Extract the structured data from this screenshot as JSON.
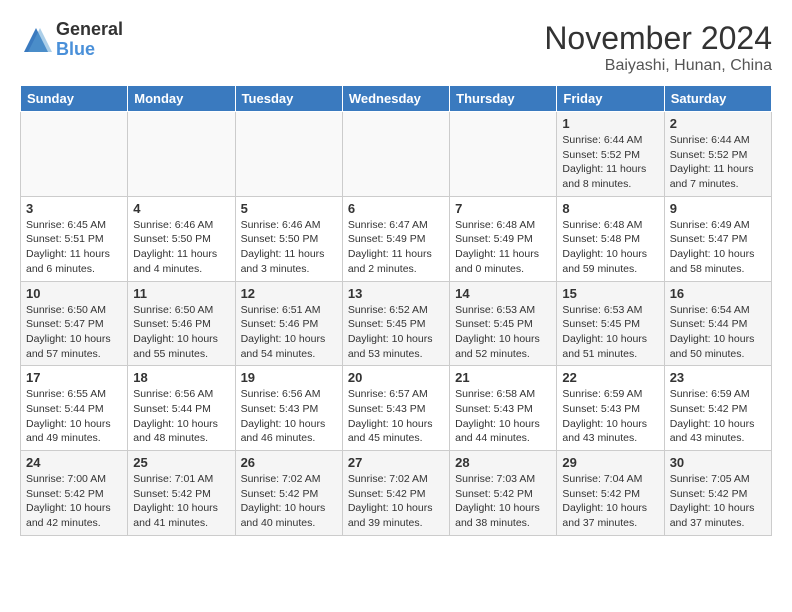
{
  "header": {
    "logo_general": "General",
    "logo_blue": "Blue",
    "month_title": "November 2024",
    "location": "Baiyashi, Hunan, China"
  },
  "weekdays": [
    "Sunday",
    "Monday",
    "Tuesday",
    "Wednesday",
    "Thursday",
    "Friday",
    "Saturday"
  ],
  "weeks": [
    [
      {
        "day": "",
        "info": ""
      },
      {
        "day": "",
        "info": ""
      },
      {
        "day": "",
        "info": ""
      },
      {
        "day": "",
        "info": ""
      },
      {
        "day": "",
        "info": ""
      },
      {
        "day": "1",
        "info": "Sunrise: 6:44 AM\nSunset: 5:52 PM\nDaylight: 11 hours and 8 minutes."
      },
      {
        "day": "2",
        "info": "Sunrise: 6:44 AM\nSunset: 5:52 PM\nDaylight: 11 hours and 7 minutes."
      }
    ],
    [
      {
        "day": "3",
        "info": "Sunrise: 6:45 AM\nSunset: 5:51 PM\nDaylight: 11 hours and 6 minutes."
      },
      {
        "day": "4",
        "info": "Sunrise: 6:46 AM\nSunset: 5:50 PM\nDaylight: 11 hours and 4 minutes."
      },
      {
        "day": "5",
        "info": "Sunrise: 6:46 AM\nSunset: 5:50 PM\nDaylight: 11 hours and 3 minutes."
      },
      {
        "day": "6",
        "info": "Sunrise: 6:47 AM\nSunset: 5:49 PM\nDaylight: 11 hours and 2 minutes."
      },
      {
        "day": "7",
        "info": "Sunrise: 6:48 AM\nSunset: 5:49 PM\nDaylight: 11 hours and 0 minutes."
      },
      {
        "day": "8",
        "info": "Sunrise: 6:48 AM\nSunset: 5:48 PM\nDaylight: 10 hours and 59 minutes."
      },
      {
        "day": "9",
        "info": "Sunrise: 6:49 AM\nSunset: 5:47 PM\nDaylight: 10 hours and 58 minutes."
      }
    ],
    [
      {
        "day": "10",
        "info": "Sunrise: 6:50 AM\nSunset: 5:47 PM\nDaylight: 10 hours and 57 minutes."
      },
      {
        "day": "11",
        "info": "Sunrise: 6:50 AM\nSunset: 5:46 PM\nDaylight: 10 hours and 55 minutes."
      },
      {
        "day": "12",
        "info": "Sunrise: 6:51 AM\nSunset: 5:46 PM\nDaylight: 10 hours and 54 minutes."
      },
      {
        "day": "13",
        "info": "Sunrise: 6:52 AM\nSunset: 5:45 PM\nDaylight: 10 hours and 53 minutes."
      },
      {
        "day": "14",
        "info": "Sunrise: 6:53 AM\nSunset: 5:45 PM\nDaylight: 10 hours and 52 minutes."
      },
      {
        "day": "15",
        "info": "Sunrise: 6:53 AM\nSunset: 5:45 PM\nDaylight: 10 hours and 51 minutes."
      },
      {
        "day": "16",
        "info": "Sunrise: 6:54 AM\nSunset: 5:44 PM\nDaylight: 10 hours and 50 minutes."
      }
    ],
    [
      {
        "day": "17",
        "info": "Sunrise: 6:55 AM\nSunset: 5:44 PM\nDaylight: 10 hours and 49 minutes."
      },
      {
        "day": "18",
        "info": "Sunrise: 6:56 AM\nSunset: 5:44 PM\nDaylight: 10 hours and 48 minutes."
      },
      {
        "day": "19",
        "info": "Sunrise: 6:56 AM\nSunset: 5:43 PM\nDaylight: 10 hours and 46 minutes."
      },
      {
        "day": "20",
        "info": "Sunrise: 6:57 AM\nSunset: 5:43 PM\nDaylight: 10 hours and 45 minutes."
      },
      {
        "day": "21",
        "info": "Sunrise: 6:58 AM\nSunset: 5:43 PM\nDaylight: 10 hours and 44 minutes."
      },
      {
        "day": "22",
        "info": "Sunrise: 6:59 AM\nSunset: 5:43 PM\nDaylight: 10 hours and 43 minutes."
      },
      {
        "day": "23",
        "info": "Sunrise: 6:59 AM\nSunset: 5:42 PM\nDaylight: 10 hours and 43 minutes."
      }
    ],
    [
      {
        "day": "24",
        "info": "Sunrise: 7:00 AM\nSunset: 5:42 PM\nDaylight: 10 hours and 42 minutes."
      },
      {
        "day": "25",
        "info": "Sunrise: 7:01 AM\nSunset: 5:42 PM\nDaylight: 10 hours and 41 minutes."
      },
      {
        "day": "26",
        "info": "Sunrise: 7:02 AM\nSunset: 5:42 PM\nDaylight: 10 hours and 40 minutes."
      },
      {
        "day": "27",
        "info": "Sunrise: 7:02 AM\nSunset: 5:42 PM\nDaylight: 10 hours and 39 minutes."
      },
      {
        "day": "28",
        "info": "Sunrise: 7:03 AM\nSunset: 5:42 PM\nDaylight: 10 hours and 38 minutes."
      },
      {
        "day": "29",
        "info": "Sunrise: 7:04 AM\nSunset: 5:42 PM\nDaylight: 10 hours and 37 minutes."
      },
      {
        "day": "30",
        "info": "Sunrise: 7:05 AM\nSunset: 5:42 PM\nDaylight: 10 hours and 37 minutes."
      }
    ]
  ]
}
